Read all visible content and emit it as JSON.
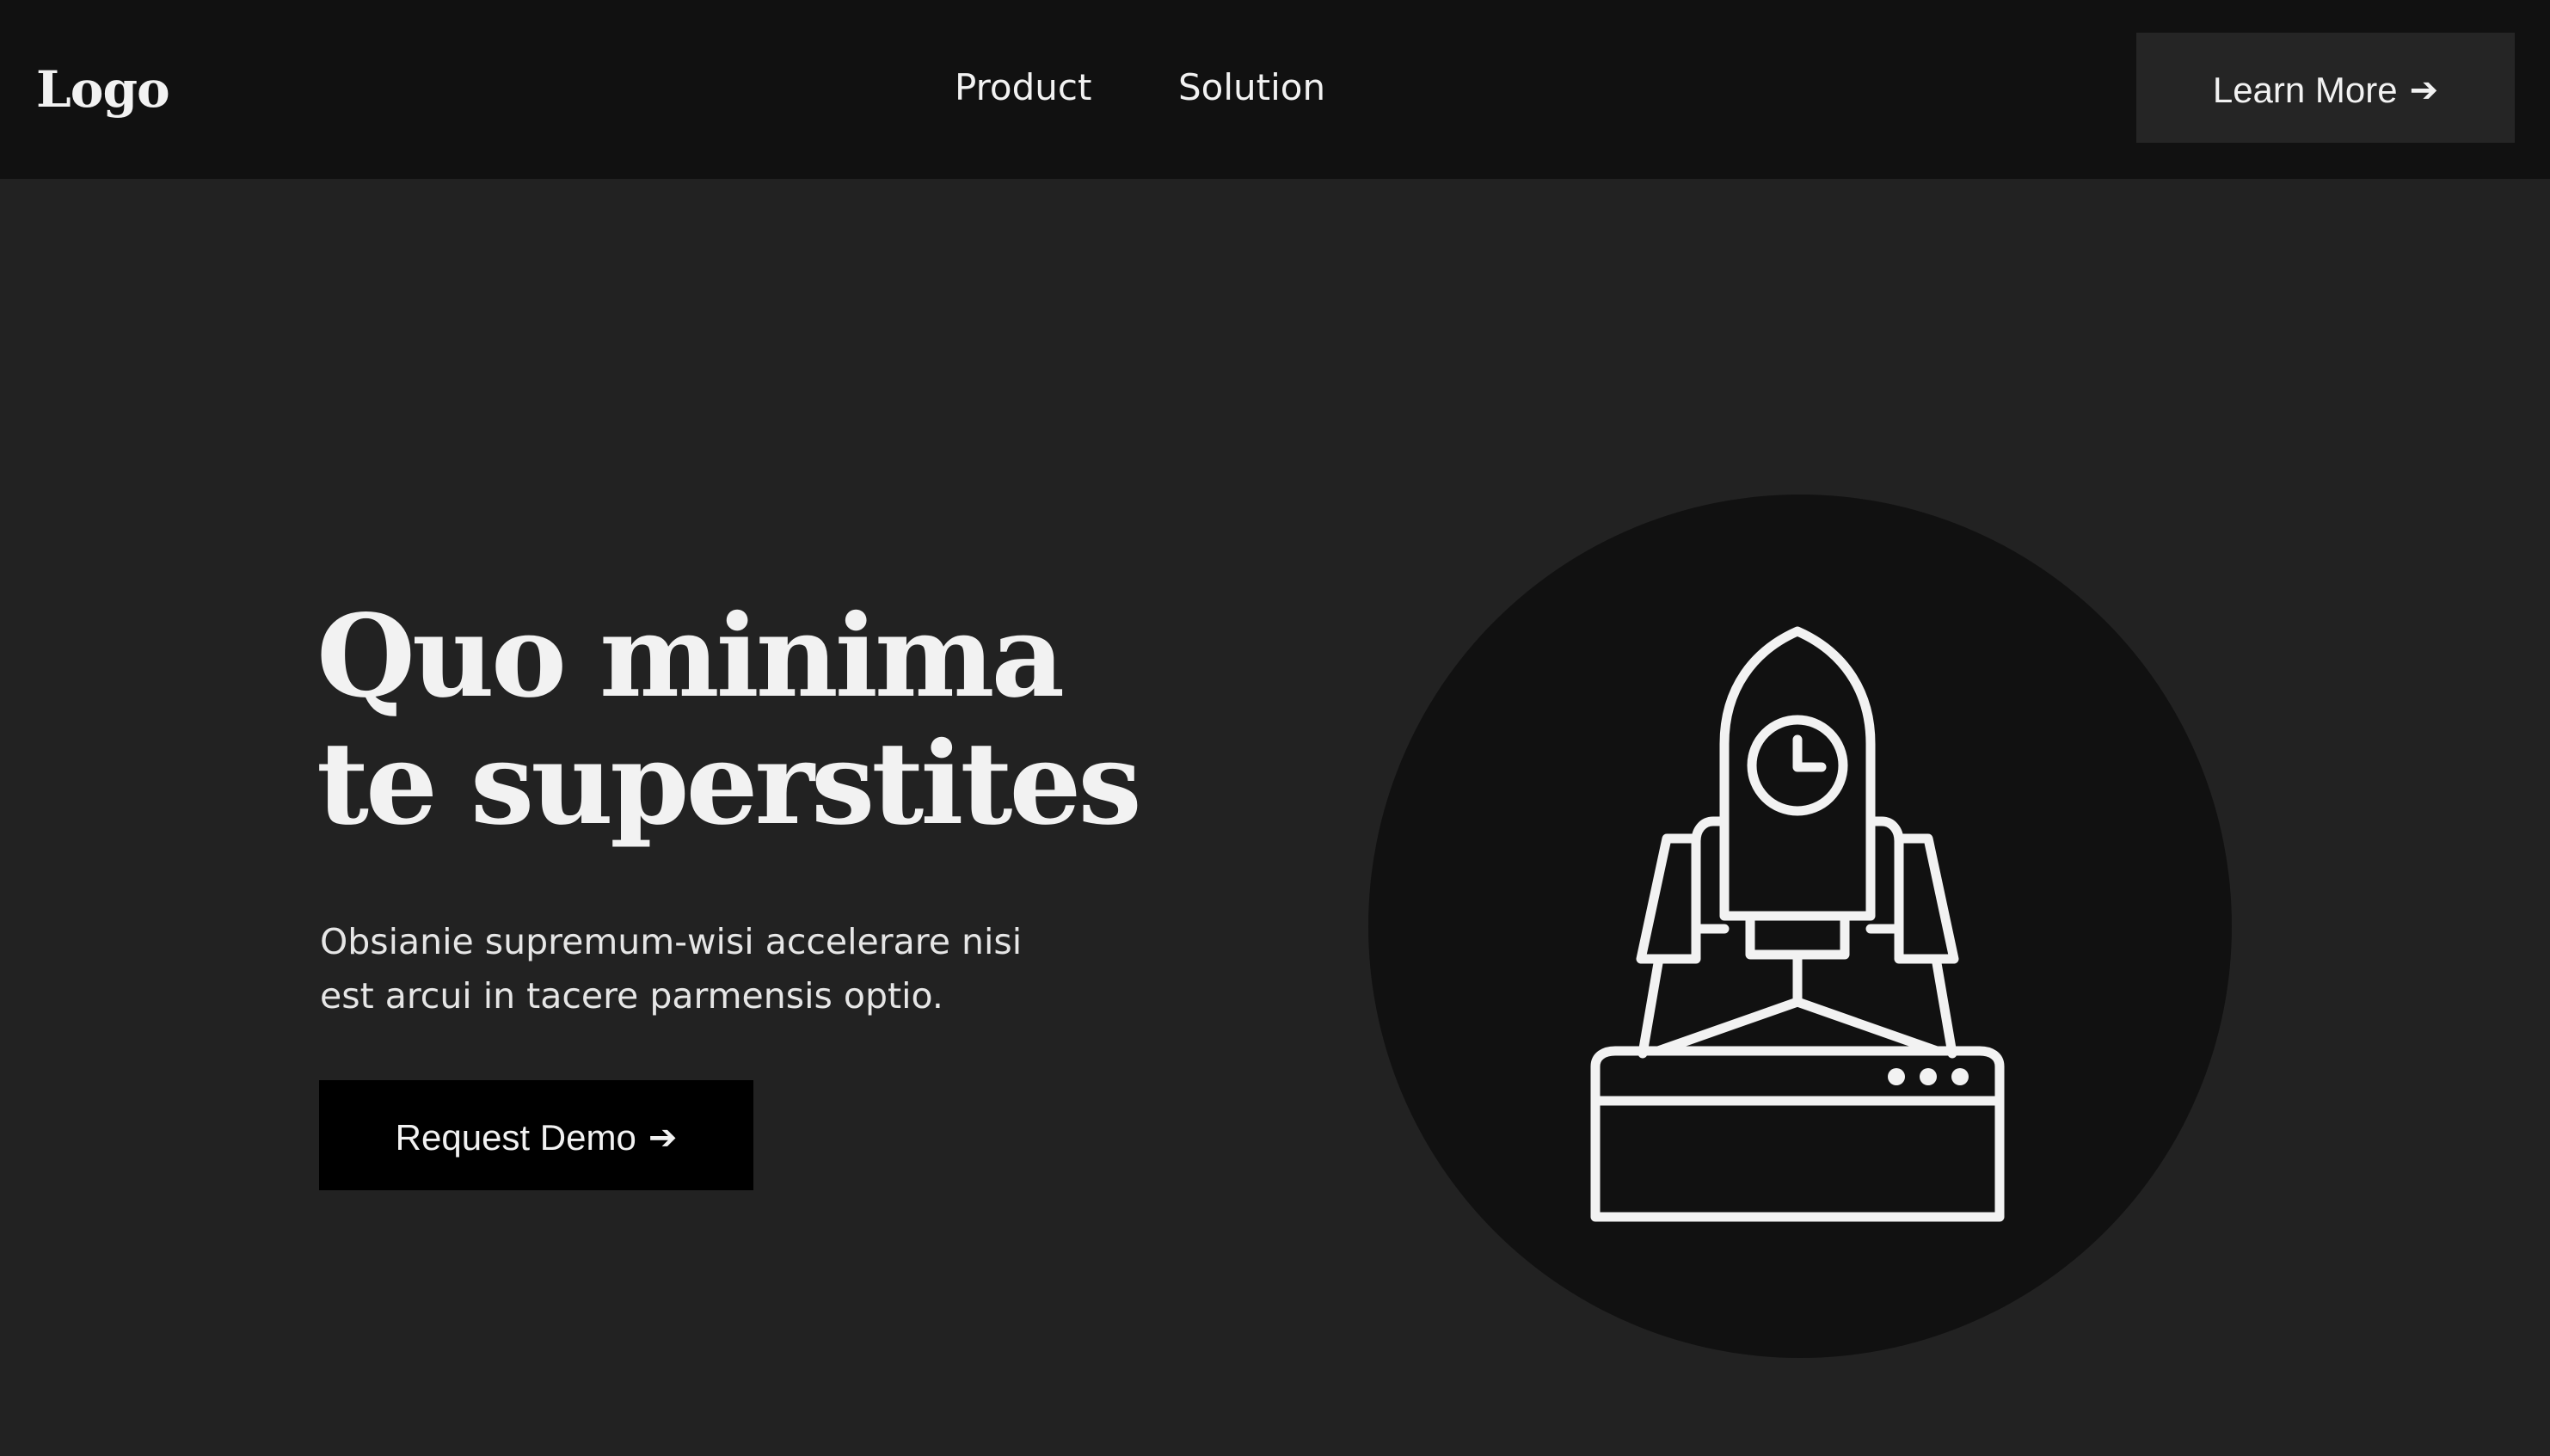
{
  "header": {
    "logo_text": "Logo",
    "nav": [
      {
        "label": "Product"
      },
      {
        "label": "Solution"
      }
    ],
    "cta_label": "Learn More",
    "cta_icon": "arrow-right-icon"
  },
  "hero": {
    "title_lines": [
      "Quo minima",
      "te superstites"
    ],
    "subtitle_lines": [
      "Obsianie supremum-wisi accelerare nisi",
      "est arcui in tacere parmensis optio."
    ],
    "cta_label": "Request Demo",
    "cta_icon": "arrow-right-icon",
    "illustration_icon": "rocket-launch-icon"
  },
  "colors": {
    "page_bg": "#222222",
    "header_bg": "#111111",
    "learn_more_bg": "#252525",
    "request_demo_bg": "#000000",
    "illustration_circle": "#111111",
    "text": "#f2f2f2"
  }
}
